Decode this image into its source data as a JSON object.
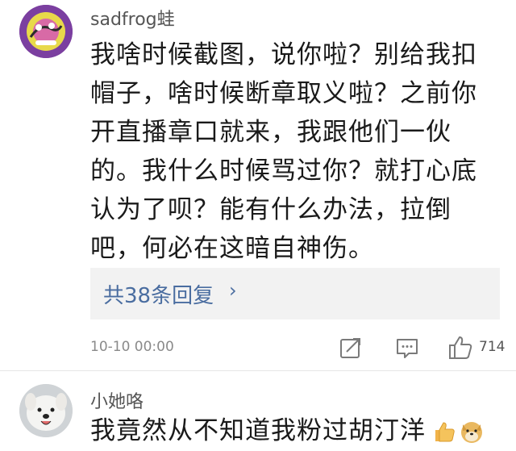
{
  "comments": [
    {
      "username": "sadfrog蛙",
      "text": "我啥时候截图，说你啦？别给我扣帽子，啥时候断章取义啦？之前你开直播章口就来，我跟他们一伙的。我什么时候骂过你？就打心底认为了呗？能有什么办法，拉倒吧，何必在这暗自神伤。",
      "replies_label": "共38条回复",
      "replies_arrow": "›",
      "timestamp": "10-10 00:00",
      "likes": "714"
    },
    {
      "username": "小她咯",
      "text": "我竟然从不知道我粉过胡汀洋"
    }
  ],
  "icons": {
    "share": "share-icon",
    "comment": "comment-icon",
    "like": "thumbs-up-icon",
    "emoji1": "thumbs-up-emoji-icon",
    "emoji2": "doge-emoji-icon"
  },
  "colors": {
    "link": "#4a6da0",
    "meta": "#8a8a8a",
    "reply_bg": "#f2f2f2"
  }
}
